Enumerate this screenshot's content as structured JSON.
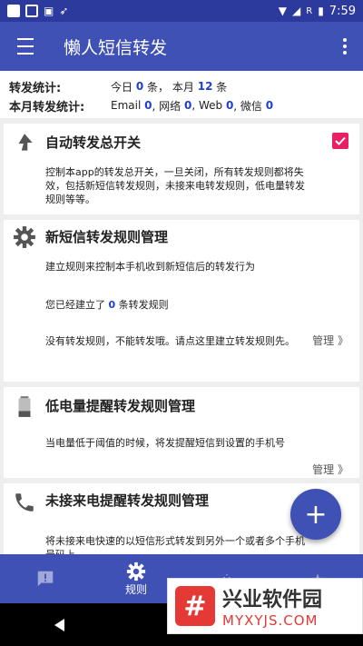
{
  "status_bar": {
    "time": "7:59",
    "carrier_flag": "R"
  },
  "app_bar": {
    "title": "懒人短信转发"
  },
  "stats": {
    "forward_label": "转发统计:",
    "today_prefix": "今日",
    "today_count": "0",
    "today_unit": "条，",
    "month_prefix": "本月",
    "month_count": "12",
    "month_unit": "条",
    "month_forward_label": "本月转发统计:",
    "email_label": "Email",
    "email_count": "0",
    "network_label": ", 网络",
    "network_count": "0",
    "web_label": ", Web",
    "web_count": "0",
    "wechat_label": ", 微信",
    "wechat_count": "0"
  },
  "cards": {
    "master": {
      "title": "自动转发总开关",
      "desc": "控制本app的转发总开关，一旦关闭，所有转发规则都将失效，包括新短信转发规则，未接来电转发规则，低电量转发规则等等。",
      "checked": true
    },
    "sms": {
      "title": "新短信转发规则管理",
      "desc": "建立规则来控制本手机收到新短信后的转发行为",
      "rule_prefix": "您已经建立了",
      "rule_count": "0",
      "rule_suffix": "条转发规则",
      "warning": "没有转发规则，不能转发哦。请点这里建立转发规则先。",
      "manage": "管理 》"
    },
    "battery": {
      "title": "低电量提醒转发规则管理",
      "desc": "当电量低于阈值的时候，将发提醒短信到设置的手机号",
      "manage": "管理 》"
    },
    "call": {
      "title": "未接来电提醒转发规则管理",
      "desc": "将未接来电快速的以短信形式转发到另外一个或者多个手机号码上"
    }
  },
  "fab": {
    "label": "+"
  },
  "bottom_nav": {
    "rules_label": "规则"
  },
  "watermark": {
    "title": "兴业软件园",
    "url": "MYXYJS.COM",
    "logo_glyph": "#"
  },
  "colors": {
    "primary": "#3f51b5",
    "status_bar": "#2b3a9c",
    "accent": "#e91e63",
    "count_blue": "#1e3fd2",
    "warning_red": "#d32f2f"
  }
}
